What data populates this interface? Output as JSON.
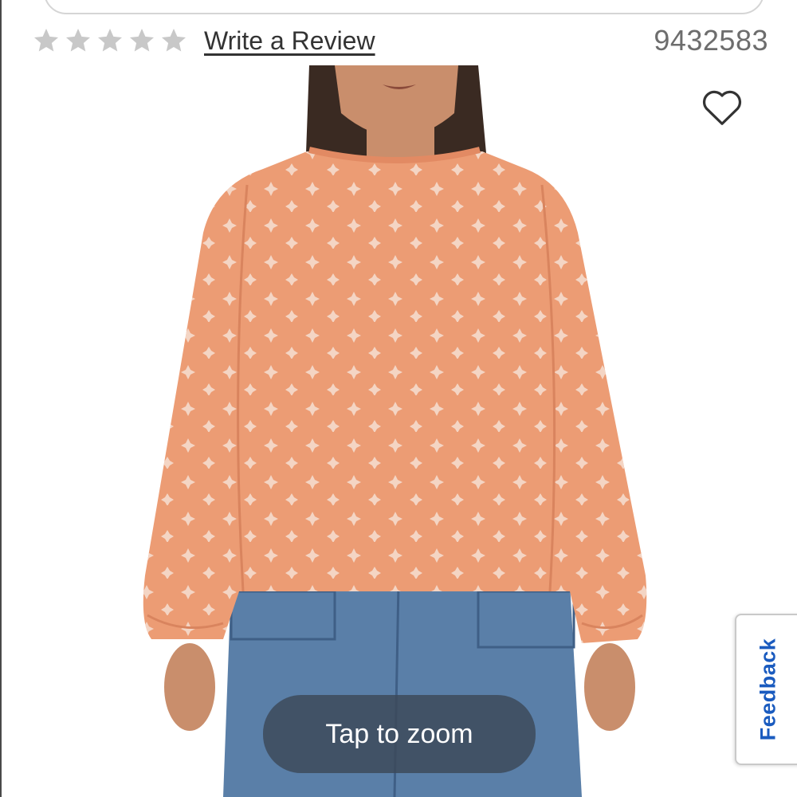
{
  "rating": {
    "stars_filled": 0,
    "stars_total": 5,
    "star_color": "#c8c8c8",
    "write_review_label": "Write a Review"
  },
  "product": {
    "id": "9432583",
    "image": {
      "blouse_color": "#ec9c74",
      "jeans_color": "#5a7fa8",
      "skin_color": "#c98e6c",
      "hair_color": "#3a2a22"
    }
  },
  "favorite": {
    "icon": "heart-outline-icon"
  },
  "zoom": {
    "label": "Tap to zoom"
  },
  "feedback": {
    "label": "Feedback",
    "color": "#1a5bbf"
  }
}
